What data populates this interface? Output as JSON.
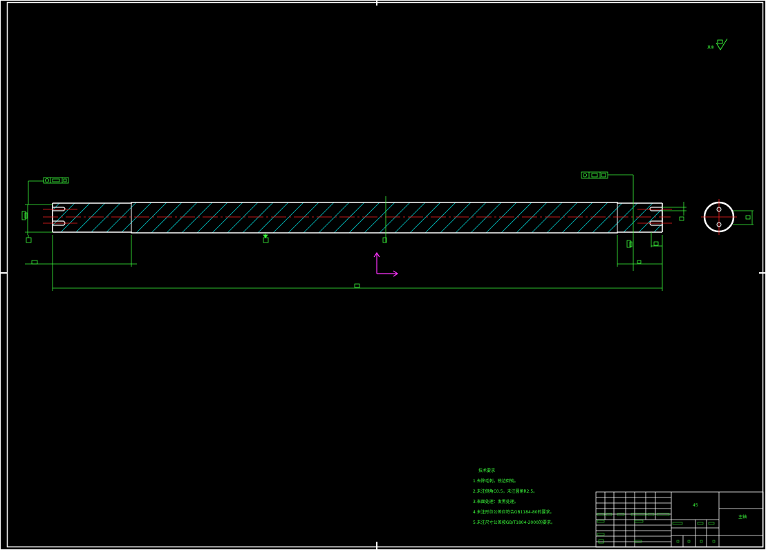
{
  "title_block": {
    "material": "45",
    "part_name": "主轴"
  },
  "surface_roughness": {
    "label": "其余"
  },
  "technical_requirements": {
    "heading": "技术要求",
    "items": [
      "1.去除毛刺，锐边倒钝。",
      "2.未注倒角C0.5，未注圆角R2.5。",
      "3.表面处理：发黑处理。",
      "4.未注形位公差应符合GB1184-80的要求。",
      "5.未注尺寸公差按GB/T1804-2000的要求。"
    ]
  },
  "colors": {
    "background": "#000000",
    "outline": "#ffffff",
    "dimension": "#3cff3c",
    "hatch": "#00c8c8",
    "centerline": "#ff2020",
    "ucs": "#ff33ff"
  }
}
